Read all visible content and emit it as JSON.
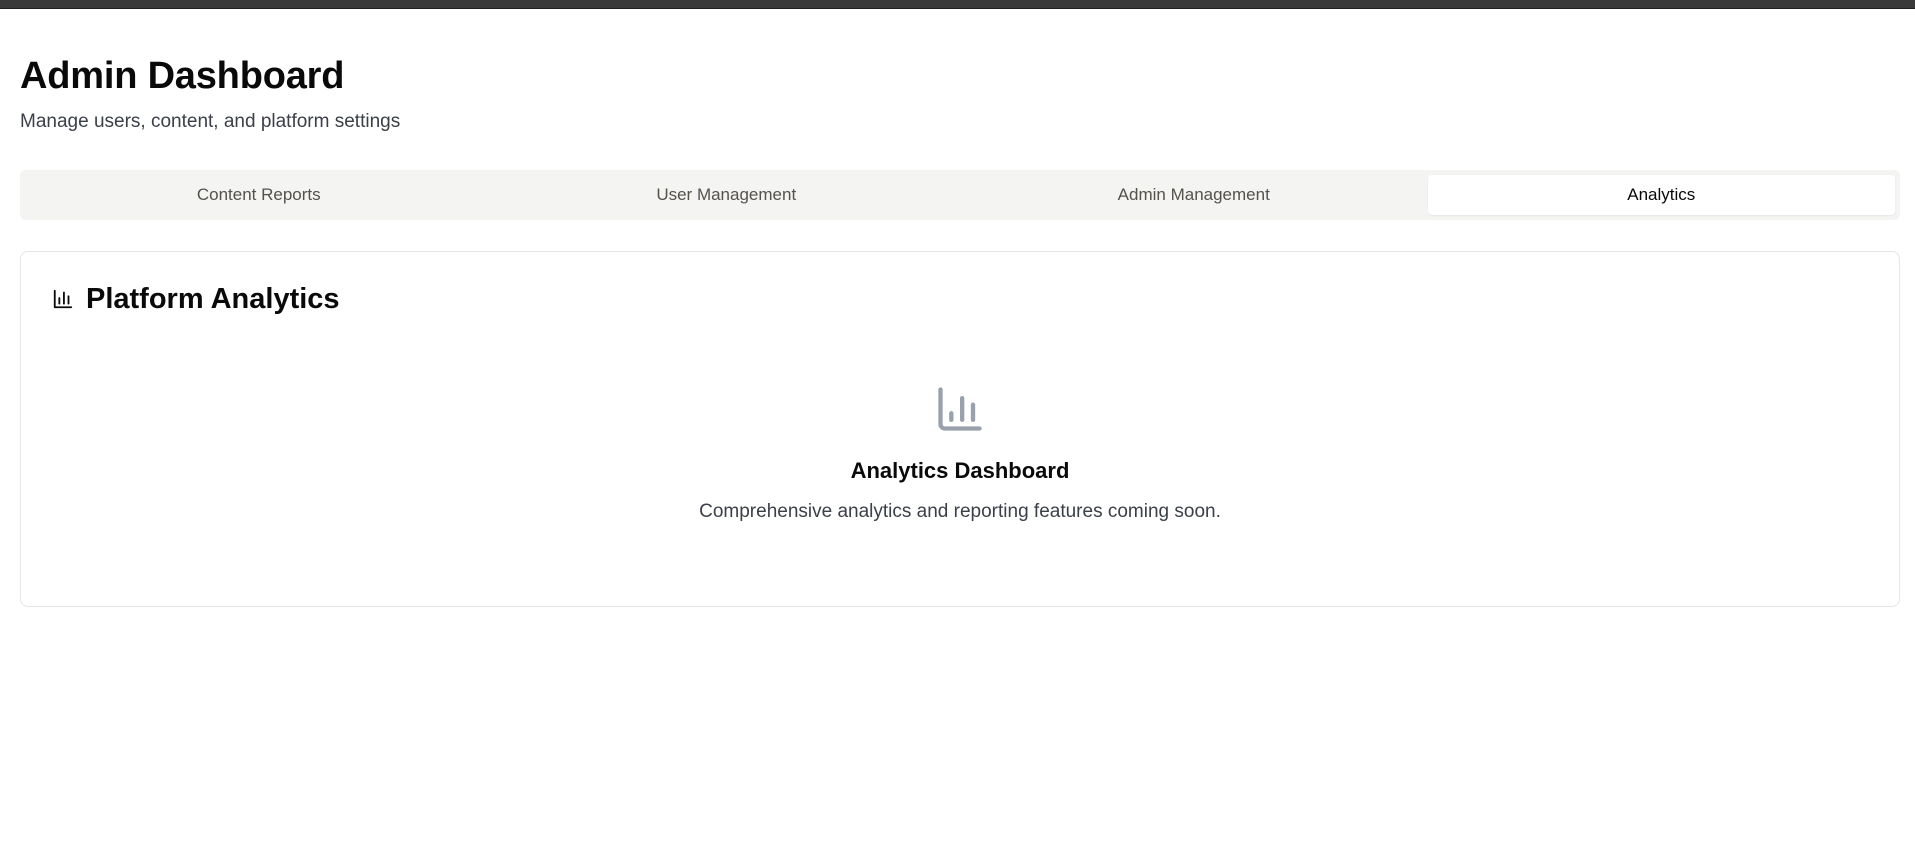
{
  "header": {
    "title": "Admin Dashboard",
    "subtitle": "Manage users, content, and platform settings"
  },
  "tabs": [
    {
      "label": "Content Reports",
      "active": false
    },
    {
      "label": "User Management",
      "active": false
    },
    {
      "label": "Admin Management",
      "active": false
    },
    {
      "label": "Analytics",
      "active": true
    }
  ],
  "analytics_card": {
    "icon": "bar-chart-icon",
    "title": "Platform Analytics",
    "empty_state": {
      "icon": "bar-chart-icon",
      "title": "Analytics Dashboard",
      "description": "Comprehensive analytics and reporting features coming soon."
    }
  },
  "colors": {
    "tab_bar_bg": "#f4f4f3",
    "active_tab_bg": "#ffffff",
    "muted_text": "#3b3f48",
    "empty_icon": "#9aa1ad"
  }
}
